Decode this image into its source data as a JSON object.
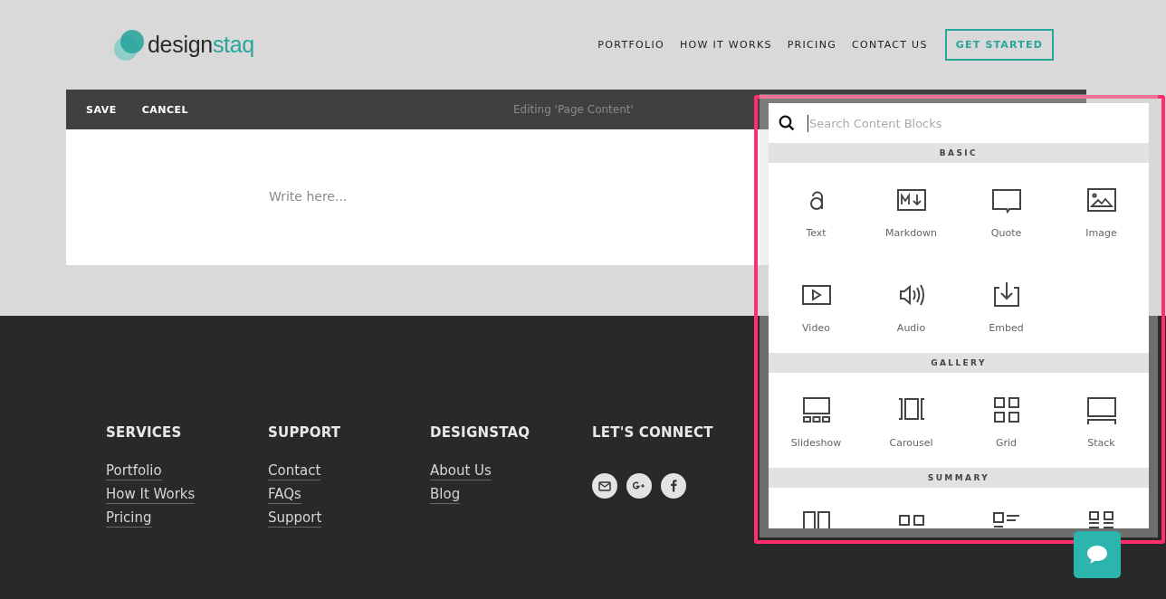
{
  "header": {
    "logo": {
      "word": "design",
      "accent": "staq"
    },
    "nav": [
      "PORTFOLIO",
      "HOW IT WORKS",
      "PRICING",
      "CONTACT US"
    ],
    "cta": "GET STARTED"
  },
  "editor": {
    "actions": [
      "SAVE",
      "CANCEL"
    ],
    "title": "Editing 'Page Content'",
    "placeholder": "Write here..."
  },
  "footer": {
    "columns": [
      {
        "heading": "SERVICES",
        "links": [
          "Portfolio",
          "How It Works",
          "Pricing"
        ]
      },
      {
        "heading": "SUPPORT",
        "links": [
          "Contact",
          "FAQs",
          "Support"
        ]
      },
      {
        "heading": "DESIGNSTAQ",
        "links": [
          "About Us",
          "Blog"
        ]
      },
      {
        "heading": "LET'S CONNECT",
        "social": [
          {
            "kind": "mail"
          },
          {
            "kind": "google-plus"
          },
          {
            "kind": "facebook"
          }
        ]
      }
    ]
  },
  "block_picker": {
    "search_placeholder": "Search Content Blocks",
    "sections": [
      {
        "title": "BASIC",
        "blocks": [
          {
            "kind": "text",
            "label": "Text"
          },
          {
            "kind": "markdown",
            "label": "Markdown"
          },
          {
            "kind": "quote",
            "label": "Quote"
          },
          {
            "kind": "image",
            "label": "Image"
          },
          {
            "kind": "video",
            "label": "Video"
          },
          {
            "kind": "audio",
            "label": "Audio"
          },
          {
            "kind": "embed",
            "label": "Embed"
          }
        ]
      },
      {
        "title": "GALLERY",
        "blocks": [
          {
            "kind": "slideshow",
            "label": "Slideshow"
          },
          {
            "kind": "carousel",
            "label": "Carousel"
          },
          {
            "kind": "grid",
            "label": "Grid"
          },
          {
            "kind": "stack",
            "label": "Stack"
          }
        ]
      },
      {
        "title": "SUMMARY",
        "blocks": [
          {
            "kind": "summary-wall"
          },
          {
            "kind": "summary-carousel"
          },
          {
            "kind": "summary-list"
          },
          {
            "kind": "summary-grid"
          }
        ]
      }
    ]
  }
}
